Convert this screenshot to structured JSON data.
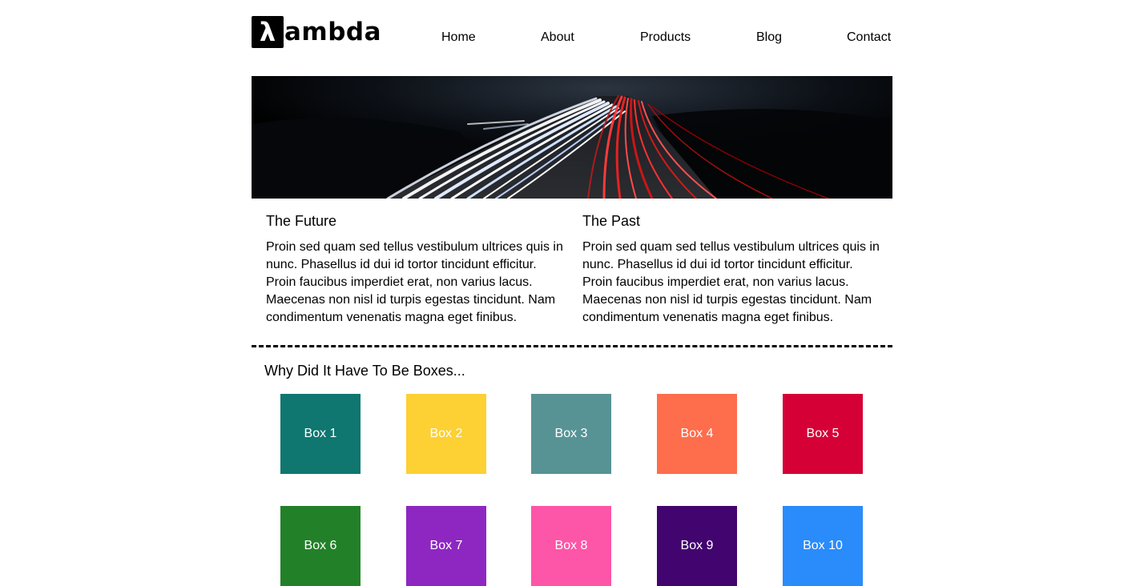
{
  "header": {
    "logo_glyph": "λ",
    "logo_text": "ambda",
    "nav": [
      {
        "label": "Home"
      },
      {
        "label": "About"
      },
      {
        "label": "Products"
      },
      {
        "label": "Blog"
      },
      {
        "label": "Contact"
      }
    ]
  },
  "hero": {
    "description": "long exposure night highway light trails"
  },
  "columns": [
    {
      "title": "The Future",
      "body": "Proin sed quam sed tellus vestibulum ultrices quis in nunc. Phasellus id dui id tortor tincidunt efficitur. Proin faucibus imperdiet erat, non varius lacus. Maecenas non nisl id turpis egestas tincidunt. Nam condimentum venenatis magna eget finibus."
    },
    {
      "title": "The Past",
      "body": "Proin sed quam sed tellus vestibulum ultrices quis in nunc. Phasellus id dui id tortor tincidunt efficitur. Proin faucibus imperdiet erat, non varius lacus. Maecenas non nisl id turpis egestas tincidunt. Nam condimentum venenatis magna eget finibus."
    }
  ],
  "boxes_section": {
    "title": "Why Did It Have To Be Boxes...",
    "boxes": [
      {
        "label": "Box 1",
        "color": "#0f7670"
      },
      {
        "label": "Box 2",
        "color": "#fdd033"
      },
      {
        "label": "Box 3",
        "color": "#579395"
      },
      {
        "label": "Box 4",
        "color": "#fe6d4c"
      },
      {
        "label": "Box 5",
        "color": "#d50136"
      },
      {
        "label": "Box 6",
        "color": "#228128"
      },
      {
        "label": "Box 7",
        "color": "#8e27c1"
      },
      {
        "label": "Box 8",
        "color": "#fd56a8"
      },
      {
        "label": "Box 9",
        "color": "#42046f"
      },
      {
        "label": "Box 10",
        "color": "#2a8bfa"
      }
    ]
  }
}
